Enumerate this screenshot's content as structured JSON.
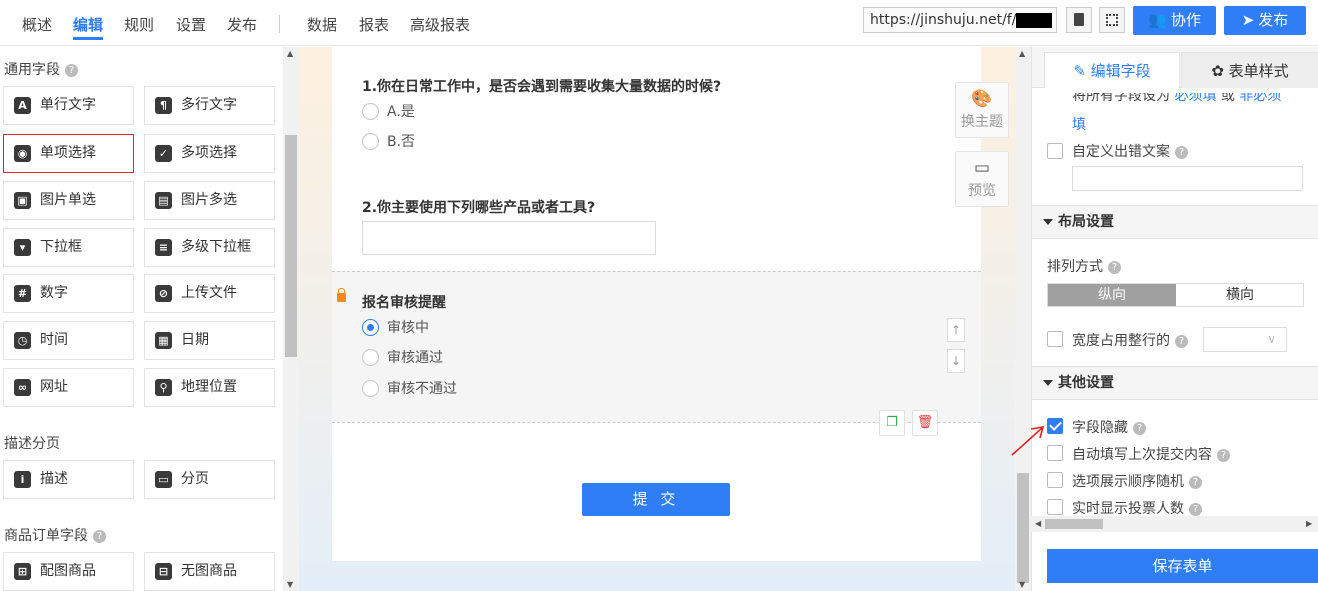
{
  "topnav": {
    "items": [
      {
        "label": "概述"
      },
      {
        "label": "编辑",
        "active": true
      },
      {
        "label": "规则"
      },
      {
        "label": "设置"
      },
      {
        "label": "发布"
      },
      {
        "label": "数据"
      },
      {
        "label": "报表"
      },
      {
        "label": "高级报表"
      }
    ],
    "url": "https://jinshuju.net/f/u",
    "collab_label": "协作",
    "publish_label": "发布"
  },
  "left_panel": {
    "common_title": "通用字段",
    "common_fields": [
      {
        "label": "单行文字",
        "icon": "A"
      },
      {
        "label": "多行文字",
        "icon": "¶"
      },
      {
        "label": "单项选择",
        "icon": "◉"
      },
      {
        "label": "多项选择",
        "icon": "✓"
      },
      {
        "label": "图片单选",
        "icon": "▣"
      },
      {
        "label": "图片多选",
        "icon": "▤"
      },
      {
        "label": "下拉框",
        "icon": "▾"
      },
      {
        "label": "多级下拉框",
        "icon": "≡"
      },
      {
        "label": "数字",
        "icon": "#"
      },
      {
        "label": "上传文件",
        "icon": "⊘"
      },
      {
        "label": "时间",
        "icon": "◷"
      },
      {
        "label": "日期",
        "icon": "▦"
      },
      {
        "label": "网址",
        "icon": "∞"
      },
      {
        "label": "地理位置",
        "icon": "⚲"
      }
    ],
    "desc_title": "描述分页",
    "desc_fields": [
      {
        "label": "描述",
        "icon": "i"
      },
      {
        "label": "分页",
        "icon": "▭"
      }
    ],
    "goods_title": "商品订单字段",
    "goods_fields": [
      {
        "label": "配图商品",
        "icon": "⊞"
      },
      {
        "label": "无图商品",
        "icon": "⊟"
      }
    ]
  },
  "form": {
    "q1": {
      "title": "1.你在日常工作中，是否会遇到需要收集大量数据的时候?",
      "options": [
        "A.是",
        "B.否"
      ]
    },
    "q2": {
      "title": "2.你主要使用下列哪些产品或者工具?"
    },
    "q3": {
      "title": "报名审核提醒",
      "options": [
        "审核中",
        "审核通过",
        "审核不通过"
      ],
      "selected": 0
    },
    "submit_label": "提 交",
    "theme_label": "换主题",
    "preview_label": "预览"
  },
  "right_panel": {
    "tab_edit": "编辑字段",
    "tab_style": "表单样式",
    "required_text_prefix": "将所有字段设为",
    "required_link": "必须填",
    "required_or": "或",
    "optional_link": "非必须",
    "required_line2": "填",
    "custom_error_label": "自定义出错文案",
    "layout_section": "布局设置",
    "arrange_label": "排列方式",
    "vertical_label": "纵向",
    "horizontal_label": "横向",
    "fullwidth_label": "宽度占用整行的",
    "other_section": "其他设置",
    "options": [
      {
        "label": "字段隐藏",
        "checked": true
      },
      {
        "label": "自动填写上次提交内容",
        "checked": false
      },
      {
        "label": "选项展示顺序随机",
        "checked": false
      },
      {
        "label": "实时显示投票人数",
        "checked": false
      }
    ],
    "save_label": "保存表单"
  },
  "colors": {
    "accent": "#2f7ef5",
    "highlight_border": "#d9272e",
    "annotation_arrow": "#e02020"
  }
}
